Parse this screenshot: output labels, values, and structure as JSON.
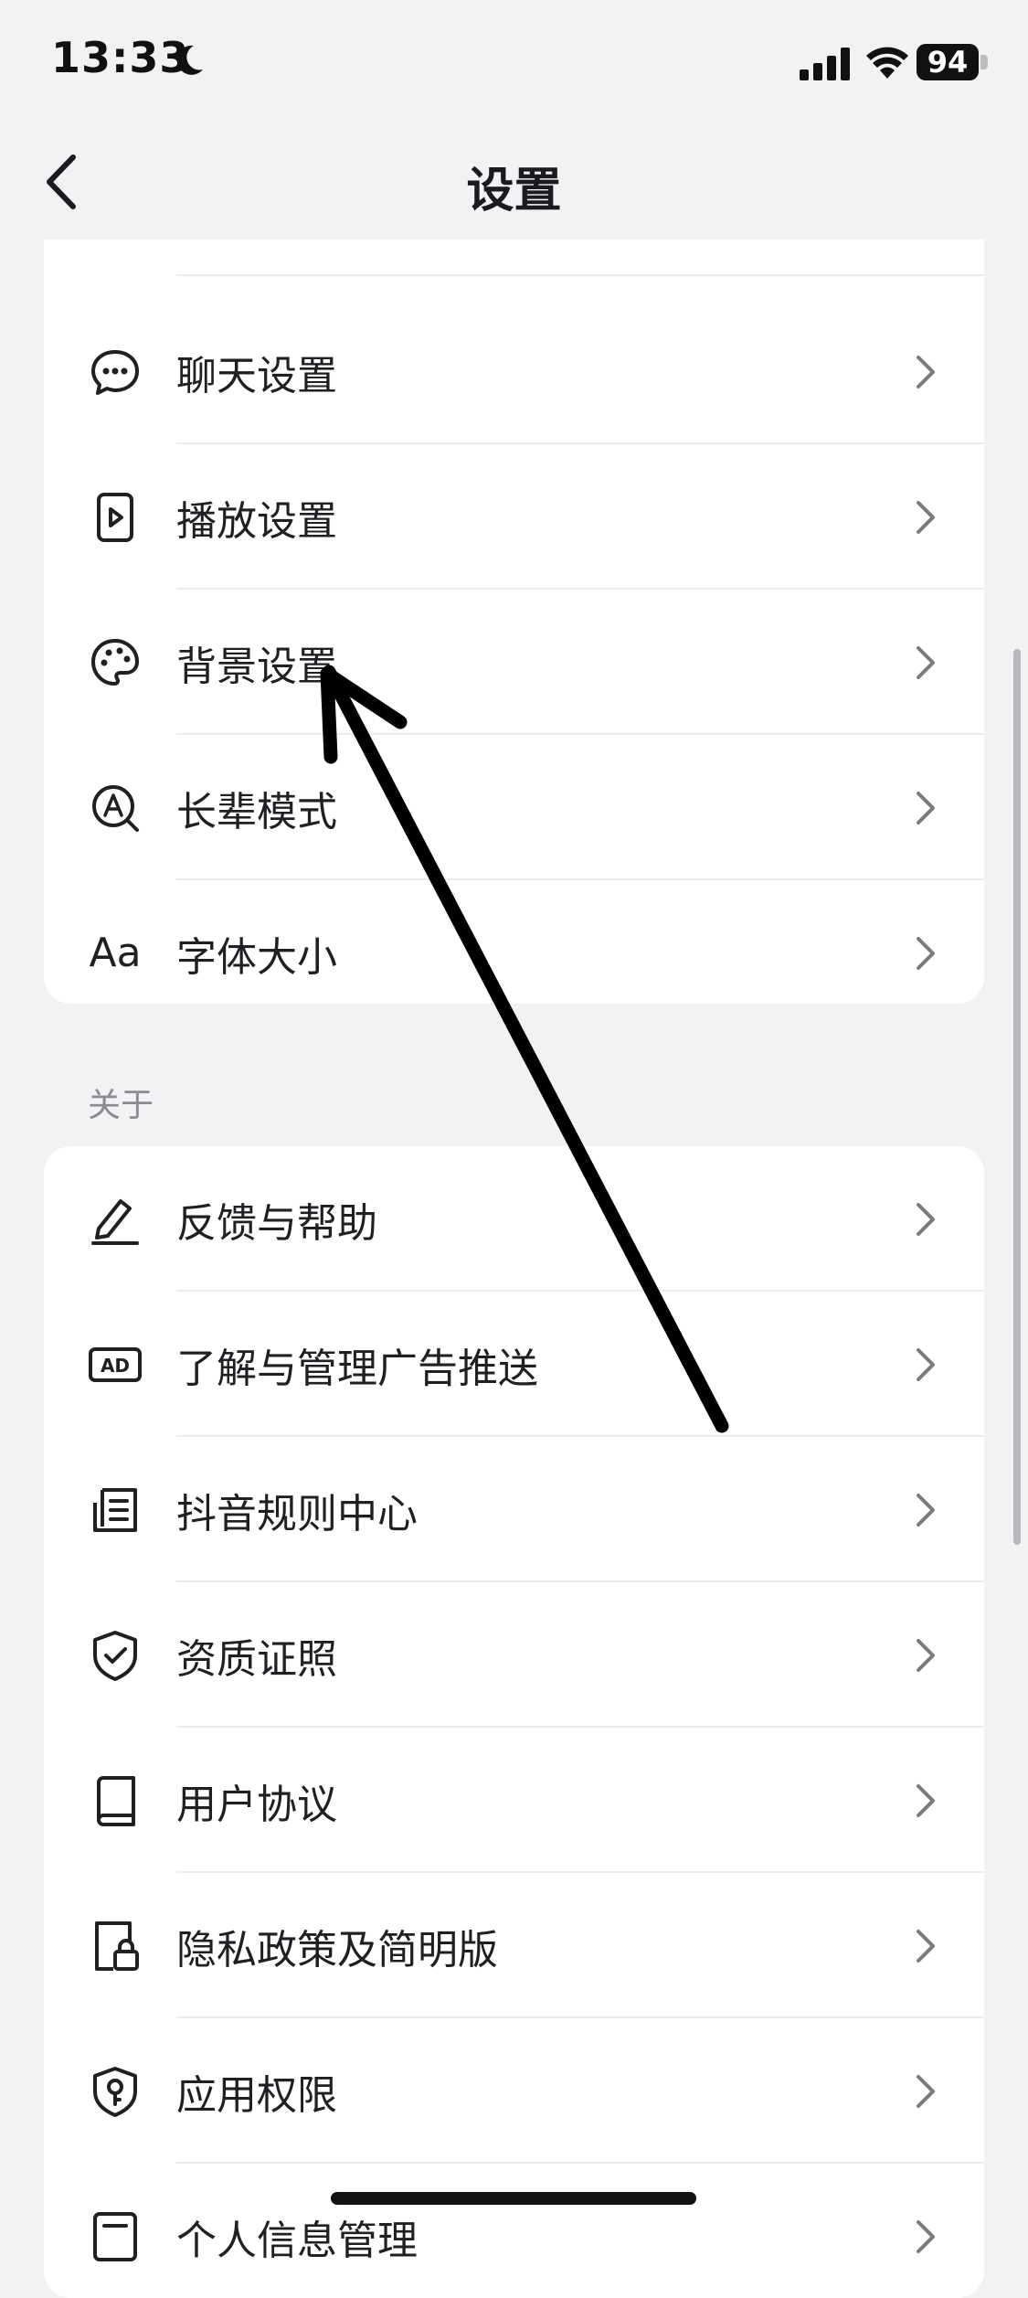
{
  "status_bar": {
    "time": "13:33",
    "battery": "94"
  },
  "header": {
    "title": "设置"
  },
  "top_card": {
    "items": [
      {
        "label": "聊天设置",
        "icon": "chat-bubble-icon"
      },
      {
        "label": "播放设置",
        "icon": "play-icon"
      },
      {
        "label": "背景设置",
        "icon": "palette-icon"
      },
      {
        "label": "长辈模式",
        "icon": "elder-mode-icon"
      },
      {
        "label": "字体大小",
        "icon": "font-size-icon",
        "glyph": "Aa"
      }
    ]
  },
  "about_section": {
    "title": "关于",
    "items": [
      {
        "label": "反馈与帮助",
        "icon": "pencil-icon"
      },
      {
        "label": "了解与管理广告推送",
        "icon": "ad-icon",
        "glyph": "AD"
      },
      {
        "label": "抖音规则中心",
        "icon": "document-icon"
      },
      {
        "label": "资质证照",
        "icon": "shield-check-icon"
      },
      {
        "label": "用户协议",
        "icon": "book-icon"
      },
      {
        "label": "隐私政策及简明版",
        "icon": "lock-file-icon"
      },
      {
        "label": "应用权限",
        "icon": "shield-key-icon"
      },
      {
        "label": "个人信息管理",
        "icon": "profile-icon"
      }
    ]
  },
  "colors": {
    "background": "#f2f2f4",
    "card": "#ffffff",
    "text": "#1f1f24",
    "muted": "#8a8a90",
    "chevron": "#7a7a80",
    "annotation_arrow": "#000000"
  }
}
